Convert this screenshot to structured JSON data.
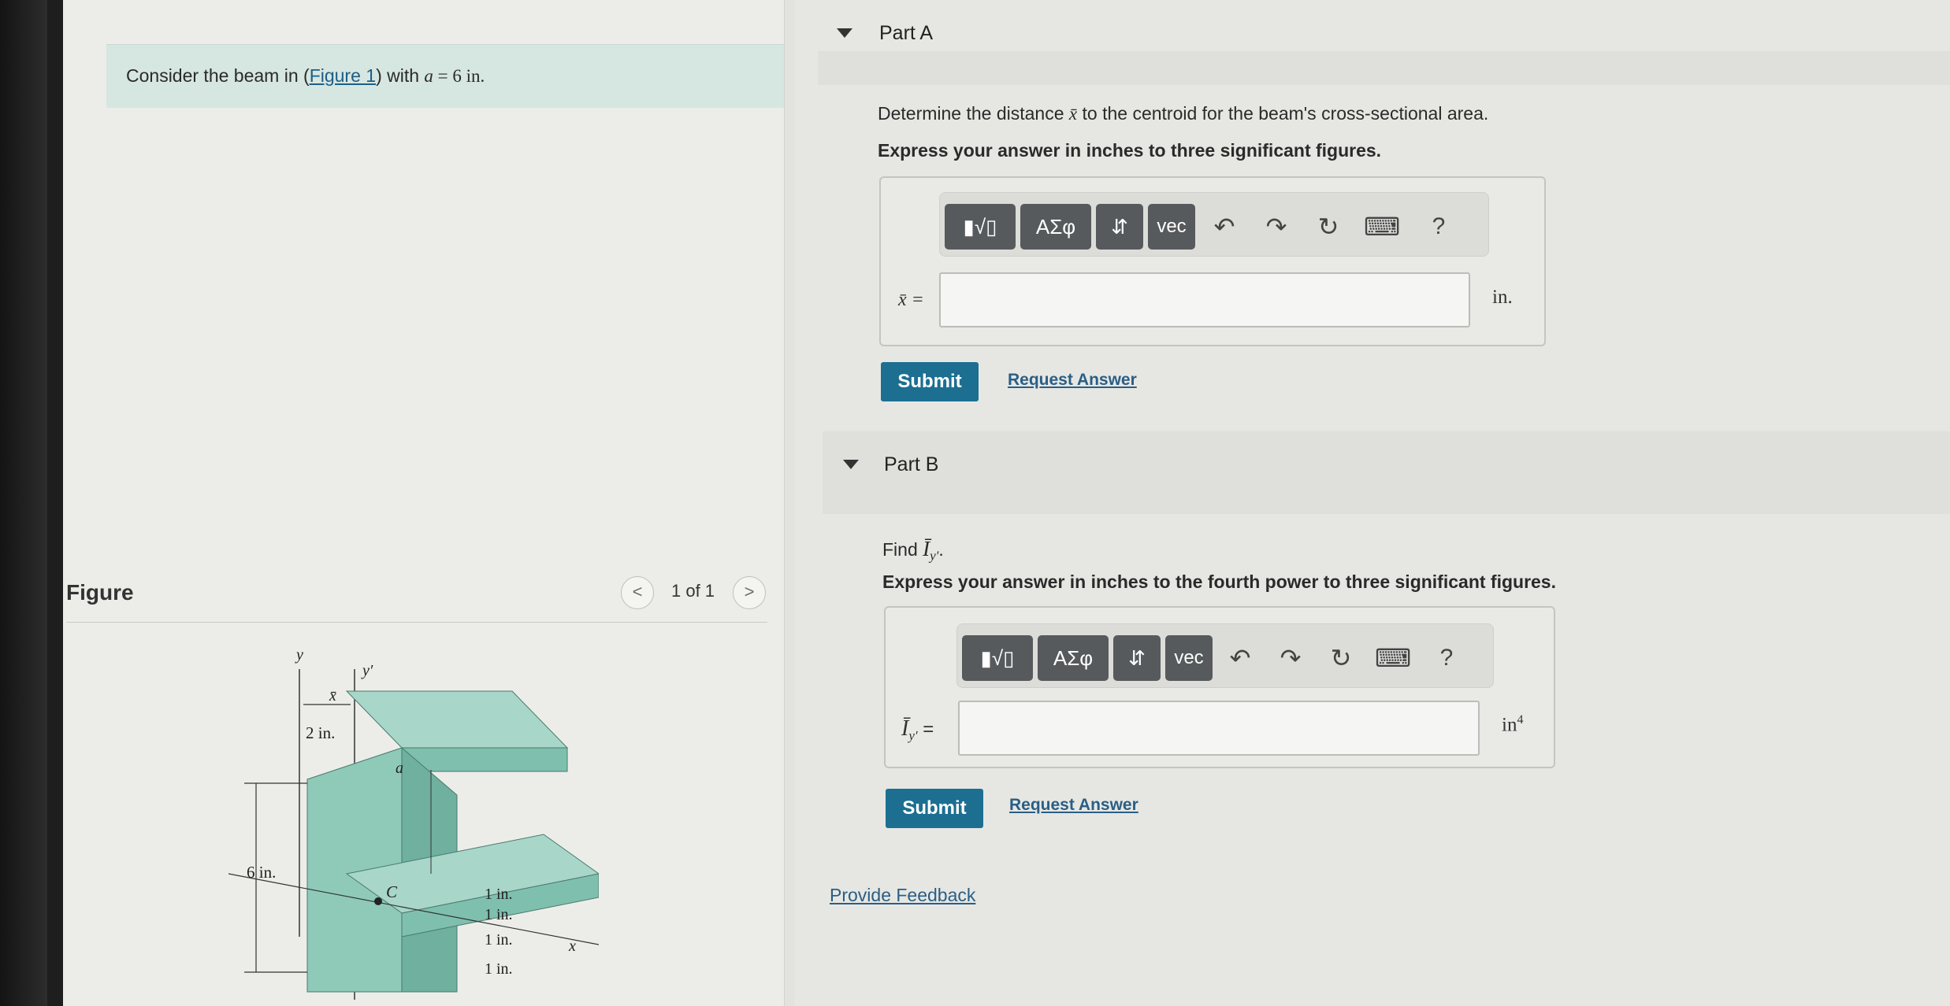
{
  "problem": {
    "intro_prefix": "Consider the beam in (",
    "figure_link": "Figure 1",
    "intro_mid": ") with ",
    "intro_var": "a",
    "intro_eq": " = 6 in."
  },
  "figure": {
    "title": "Figure",
    "pager": "1 of 1",
    "prev": "<",
    "next": ">",
    "labels": {
      "y": "y",
      "y_prime": "y′",
      "x_bar": "x̄",
      "x": "x",
      "a": "a",
      "c": "C",
      "dim_2in": "2 in.",
      "dim_6in": "6 in.",
      "dim_1in_a": "1 in.",
      "dim_1in_b": "1 in.",
      "dim_1in_c": "1 in.",
      "dim_1in_d": "1 in."
    }
  },
  "part_a": {
    "title": "Part A",
    "question_prefix": "Determine the distance ",
    "question_var": "x̄",
    "question_suffix": " to the centroid for the beam's cross-sectional area.",
    "instruction": "Express your answer in inches to three significant figures.",
    "answer_label": "x̄ =",
    "answer_value": "",
    "unit": "in.",
    "submit": "Submit",
    "request": "Request Answer"
  },
  "part_b": {
    "title": "Part B",
    "question_prefix": "Find ",
    "question_var": "Ī",
    "question_sub": "y′",
    "question_suffix": ".",
    "instruction": "Express your answer in inches to the fourth power to three significant figures.",
    "answer_label_var": "Ī",
    "answer_label_sub": "y′",
    "answer_label_eq": " =",
    "answer_value": "",
    "unit": "in",
    "unit_sup": "4",
    "submit": "Submit",
    "request": "Request Answer"
  },
  "toolbar": {
    "templates": "▮√▯",
    "greek": "ΑΣφ",
    "sort": "⇵",
    "vec": "vec",
    "undo": "↶",
    "redo": "↷",
    "reset": "↻",
    "keyboard": "⌨",
    "help": "?"
  },
  "feedback": "Provide Feedback",
  "colors": {
    "submit": "#1c6f91",
    "link": "#2a5e85",
    "intro_bg": "#d6e6e1",
    "beam": "#7fbfae"
  }
}
